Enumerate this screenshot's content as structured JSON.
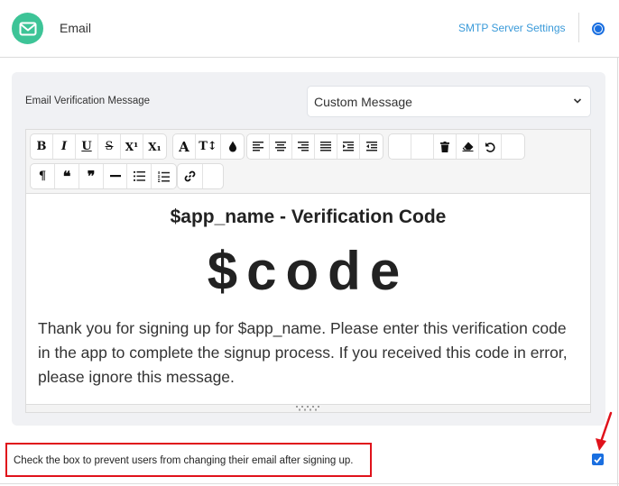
{
  "header": {
    "icon": "envelope-icon",
    "title": "Email",
    "smtp_link": "SMTP Server Settings",
    "radio_selected": true
  },
  "panel": {
    "field_label": "Email Verification Message",
    "select": {
      "value": "Custom Message"
    }
  },
  "toolbar": {
    "row1": [
      {
        "group": [
          "bold",
          "italic",
          "underline",
          "strikethrough",
          "superscript",
          "subscript"
        ]
      },
      {
        "group": [
          "font-color",
          "font-size",
          "highlight"
        ]
      },
      {
        "group": [
          "align-left",
          "align-center",
          "align-right",
          "justify",
          "indent",
          "outdent"
        ]
      },
      {
        "group": [
          "blank",
          "blank",
          "delete",
          "eraser",
          "undo",
          "blank"
        ]
      }
    ],
    "row2": [
      {
        "group": [
          "paragraph",
          "blockquote-open",
          "blockquote-close",
          "horizontal-rule",
          "bullet-list",
          "ordered-list"
        ]
      },
      {
        "group": [
          "link",
          "blank"
        ]
      }
    ],
    "glyphs": {
      "bold": "B",
      "italic": "I",
      "underline": "U",
      "strikethrough": "S",
      "superscript": "X¹",
      "subscript": "X₁",
      "font_color": "A",
      "font_size": "T↕",
      "paragraph": "¶",
      "blockquote_open": "❝",
      "blockquote_close": "❞"
    }
  },
  "editor": {
    "title": "$app_name - Verification Code",
    "code": "$code",
    "body": "Thank you for signing up for $app_name. Please enter this verification code in the app to complete the signup process. If you received this code in error, please ignore this message."
  },
  "footer": {
    "note": "Check the box to prevent users from changing their email after signing up.",
    "checkbox_checked": true
  },
  "colors": {
    "brand_green": "#3dc497",
    "link_blue": "#3a9ad9",
    "accent_blue": "#1a6fe0",
    "highlight_red": "#e0121b"
  }
}
